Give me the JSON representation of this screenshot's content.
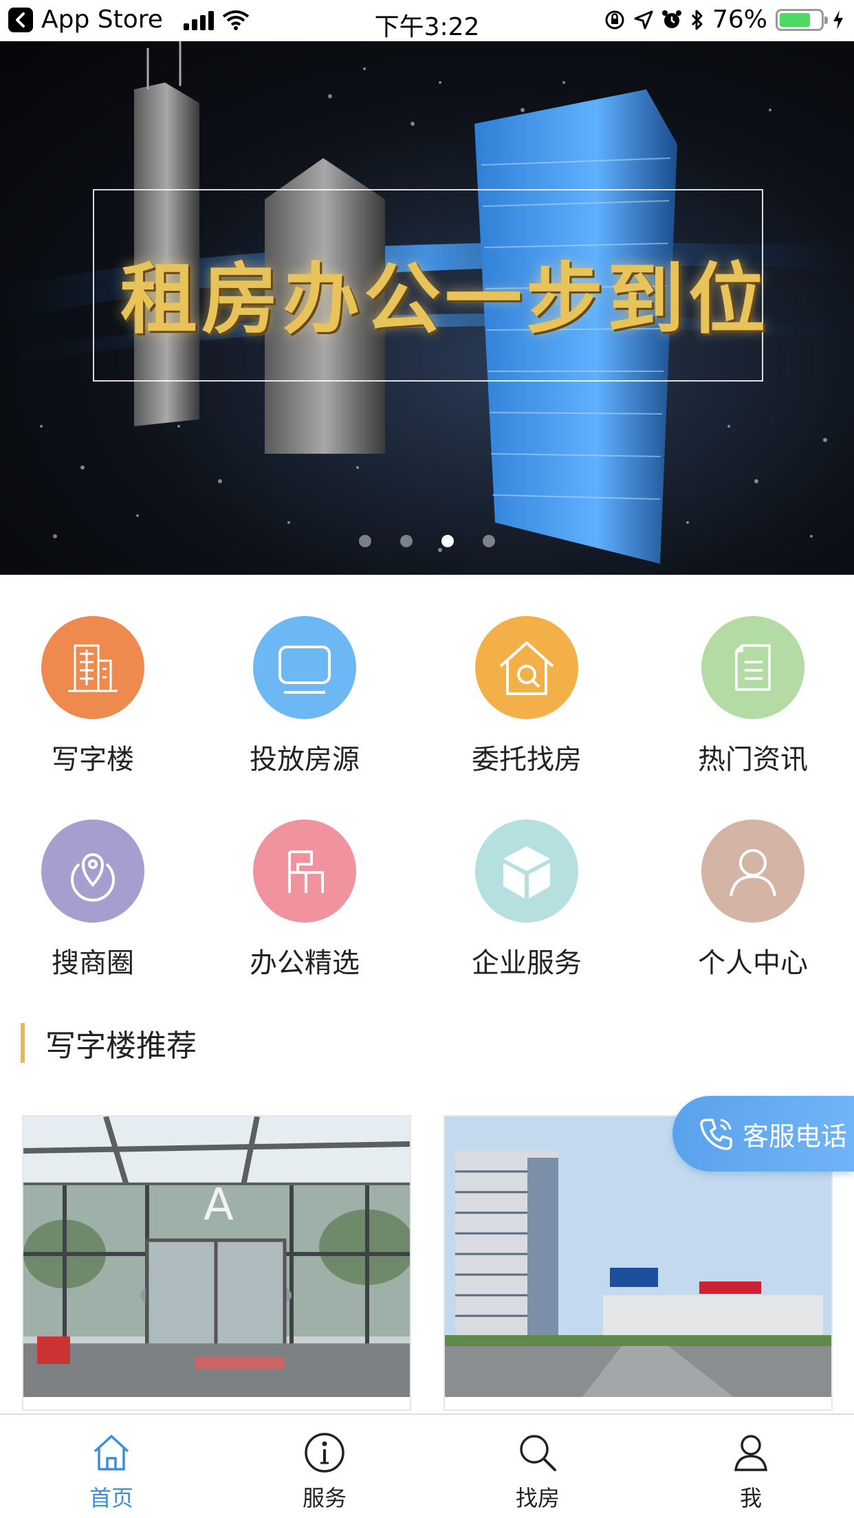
{
  "status_bar": {
    "back_app": "App Store",
    "time": "下午3:22",
    "battery": "76%",
    "battery_level": 0.76
  },
  "banner": {
    "headline": "租房办公一步到位",
    "slide_count": 4,
    "active_slide": 3
  },
  "grid": {
    "items": [
      {
        "label": "写字楼",
        "icon": "office-building-icon",
        "color": "#ee8a4e"
      },
      {
        "label": "投放房源",
        "icon": "monitor-icon",
        "color": "#6cb8f4"
      },
      {
        "label": "委托找房",
        "icon": "house-search-icon",
        "color": "#f3b048"
      },
      {
        "label": "热门资讯",
        "icon": "document-icon",
        "color": "#b5dba4"
      },
      {
        "label": "搜商圈",
        "icon": "location-pin-icon",
        "color": "#a59fd0"
      },
      {
        "label": "办公精选",
        "icon": "desk-chair-icon",
        "color": "#f0939f"
      },
      {
        "label": "企业服务",
        "icon": "box-icon",
        "color": "#b6dfe0"
      },
      {
        "label": "个人中心",
        "icon": "user-icon",
        "color": "#d4b4a4"
      }
    ]
  },
  "section": {
    "title": "写字楼推荐"
  },
  "floating": {
    "service_label": "客服电话"
  },
  "tabbar": {
    "items": [
      {
        "label": "首页",
        "icon": "home-icon",
        "active": true
      },
      {
        "label": "服务",
        "icon": "info-icon",
        "active": false
      },
      {
        "label": "找房",
        "icon": "search-icon",
        "active": false
      },
      {
        "label": "我",
        "icon": "person-icon",
        "active": false
      }
    ],
    "active_color": "#3b8fd9"
  }
}
